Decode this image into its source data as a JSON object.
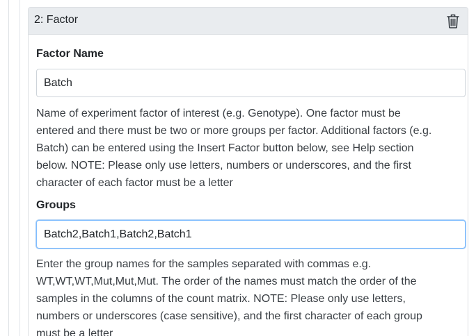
{
  "card": {
    "title": "2: Factor",
    "delete_icon": "trash-icon"
  },
  "factor_name": {
    "label": "Factor Name",
    "value": "Batch",
    "help_lines": [
      "Name of experiment factor of interest (e.g. Genotype). One factor must be",
      "entered and there must be two or more groups per factor. Additional factors (e.g.",
      "Batch) can be entered using the Insert Factor button below, see Help section",
      "below. NOTE: Please only use letters, numbers or underscores, and the first",
      "character of each factor must be a letter"
    ]
  },
  "groups": {
    "label": "Groups",
    "value": "Batch2,Batch1,Batch2,Batch1",
    "help_lines": [
      "Enter the group names for the samples separated with commas e.g.",
      "WT,WT,WT,Mut,Mut,Mut. The order of the names must match the order of the",
      "samples in the columns of the count matrix. NOTE: Please only use letters,",
      "numbers or underscores (case sensitive), and the first character of each group",
      "must be a letter"
    ]
  },
  "colors": {
    "header_bg": "#e9ecef",
    "focus_border": "#80bdff",
    "input_border": "#ced4da"
  }
}
